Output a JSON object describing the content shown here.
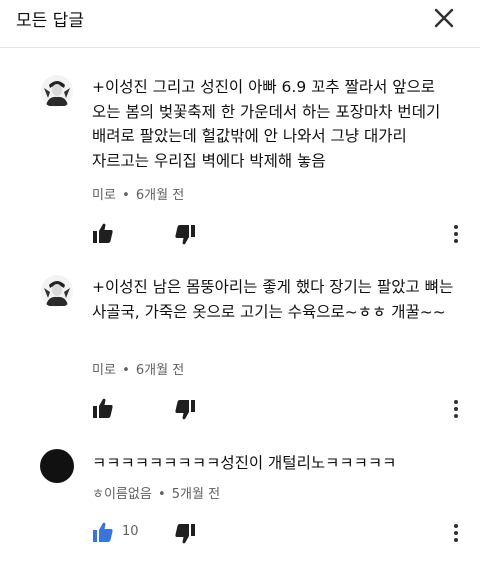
{
  "header": {
    "title": "모든 답글",
    "close_icon": "close-icon"
  },
  "colors": {
    "liked_blue": "#3a75d9",
    "icon_dark": "#1f1f1f",
    "meta_gray": "#606060"
  },
  "comments": [
    {
      "text": "+이성진 그리고 성진이 아빠 6.9 꼬추 짤라서 앞으로 오는 봄의 벚꽃축제 한 가운데서 하는 포장마차 번데기 배려로 팔았는데 헐값밖에 안 나와서 그냥 대가리 자르고는 우리집 벽에다 박제해 놓음",
      "author": "미로",
      "time": "6개월 전",
      "meta_sep": "•",
      "likes": "",
      "liked": false
    },
    {
      "text": "+이성진 남은 몸뚱아리는 좋게 했다 장기는 팔았고 뼈는 사골국, 가죽은 옷으로 고기는 수육으로~ㅎㅎ 개꿀~~",
      "author": "미로",
      "time": "6개월 전",
      "meta_sep": "•",
      "likes": "",
      "liked": false
    },
    {
      "text": "ㅋㅋㅋㅋㅋㅋㅋㅋㅋ성진이 개털리노ㅋㅋㅋㅋㅋ",
      "author": "ㅎ이름없음",
      "time": "5개월 전",
      "meta_sep": "•",
      "likes": "10",
      "liked": true
    }
  ]
}
